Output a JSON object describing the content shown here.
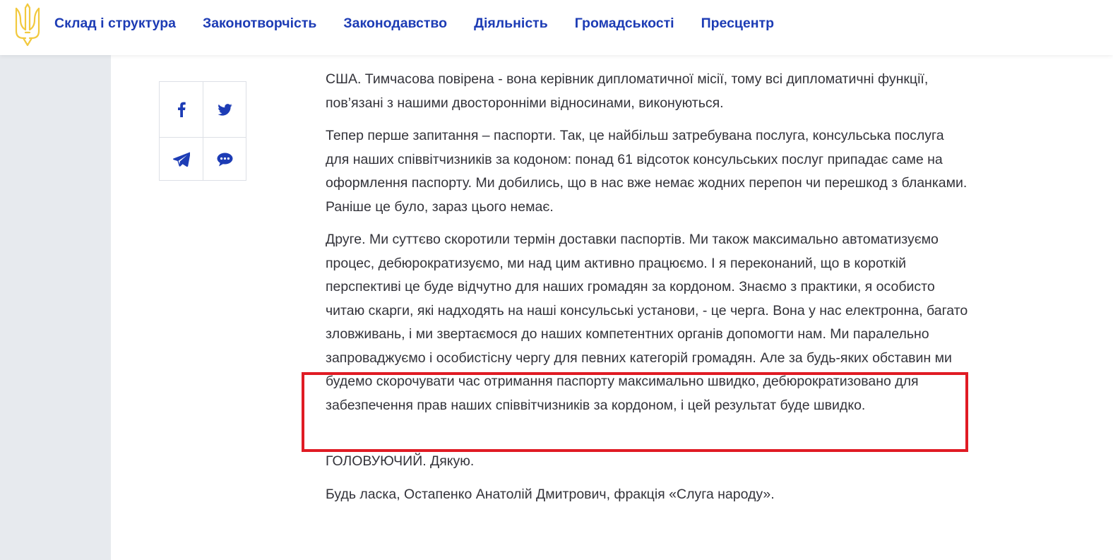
{
  "header": {
    "logo_icon": "ukraine-trident-icon",
    "nav": [
      {
        "label": "Склад і структура"
      },
      {
        "label": "Законотворчість"
      },
      {
        "label": "Законодавство"
      },
      {
        "label": "Діяльність"
      },
      {
        "label": "Громадськості"
      },
      {
        "label": "Пресцентр"
      }
    ]
  },
  "share": {
    "buttons": [
      {
        "icon": "facebook-icon"
      },
      {
        "icon": "twitter-icon"
      },
      {
        "icon": "telegram-icon"
      },
      {
        "icon": "viber-icon"
      }
    ]
  },
  "colors": {
    "nav_text": "#1d3cb5",
    "icon": "#1d3cb5",
    "logo_gold": "#f2c93e",
    "highlight_border": "#e01b24",
    "side_panel": "#e7eaee"
  },
  "article": {
    "paragraphs": [
      "США. Тимчасова повірена - вона керівник дипломатичної місії, тому всі дипломатичні функції, пов’язані з нашими двосторонніми відносинами, виконуються.",
      "Тепер перше запитання – паспорти. Так, це найбільш затребувана послуга, консульська послуга для наших співвітчизників за кодоном: понад 61 відсоток консульських послуг припадає саме на оформлення паспорту. Ми добились, що в нас вже немає жодних перепон чи перешкод з бланками. Раніше це було, зараз цього немає.",
      "Друге. Ми суттєво скоротили термін доставки паспортів. Ми також максимально автоматизуємо процес, дебюрократизуємо, ми над цим активно працюємо. І я переконаний, що в короткій перспективі це буде відчутно для наших громадян за кордоном. Знаємо з практики, я особисто читаю скарги, які надходять на наші консульські установи, - це черга. Вона у нас електронна, багато зловживань, і ми звертаємося до наших компетентних органів допомогти нам. Ми паралельно запроваджуємо і особистісну чергу для певних категорій громадян. Але за будь-яких обставин ми будемо скорочувати час отримання паспорту максимально швидко, дебюрократизовано для забезпечення прав наших співвітчизників за кордоном, і цей результат буде швидко.",
      "ГОЛОВУЮЧИЙ.  Дякую.",
      "Будь ласка, Остапенко Анатолій Дмитрович, фракція «Слуга народу»."
    ]
  }
}
